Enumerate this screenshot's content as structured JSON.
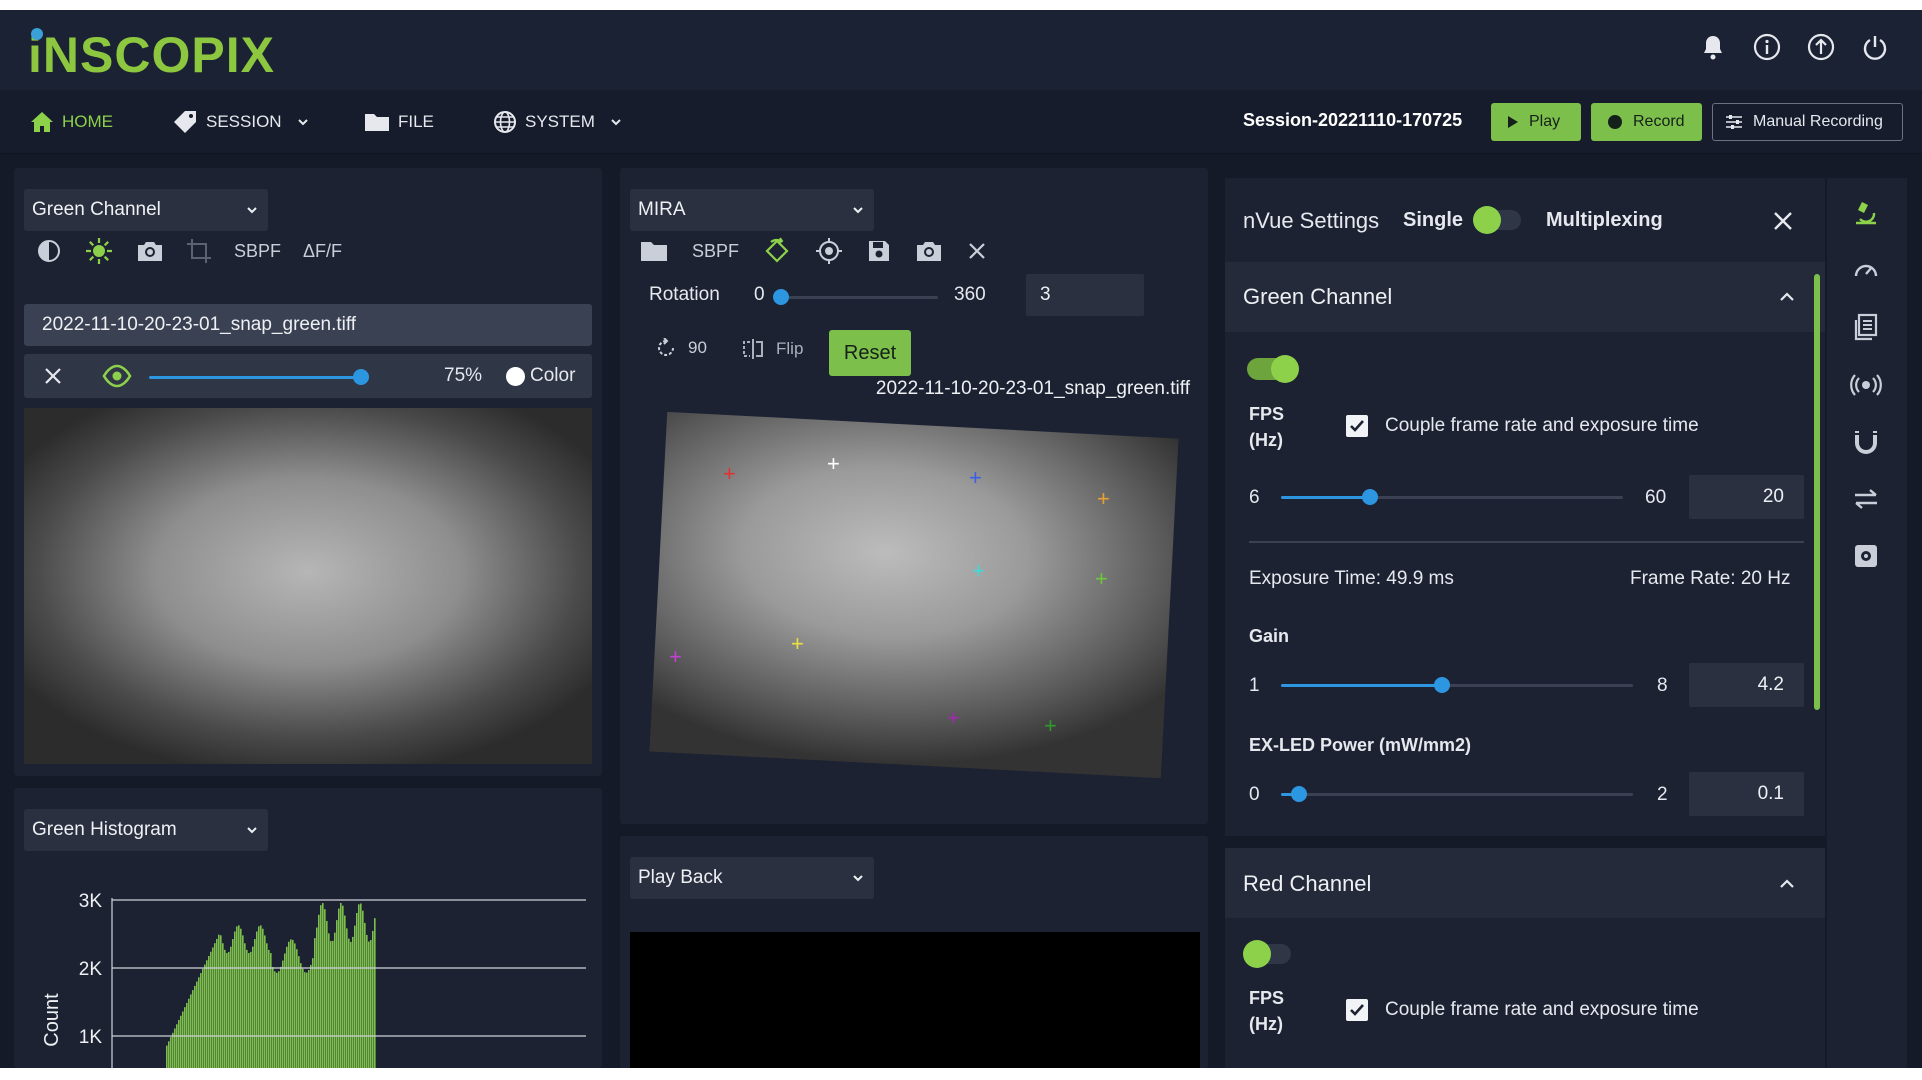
{
  "app": {
    "logo": "iNSCOPIX"
  },
  "topbar": {
    "icons": [
      "bell-icon",
      "info-icon",
      "upload-icon",
      "power-icon"
    ]
  },
  "nav": {
    "home": "HOME",
    "session": "SESSION",
    "file": "FILE",
    "system": "SYSTEM",
    "session_name": "Session-20221110-170725",
    "play": "Play",
    "record": "Record",
    "manual_recording": "Manual Recording"
  },
  "left_panel": {
    "channel_select": "Green Channel",
    "tools": {
      "sbpf": "SBPF",
      "dff": "ΔF/F"
    },
    "filename": "2022-11-10-20-23-01_snap_green.tiff",
    "opacity": "75%",
    "opacity_value": 0.75,
    "color_label": "Color"
  },
  "histogram": {
    "select": "Green Histogram",
    "chart_data": {
      "type": "bar",
      "ylabel": "Count",
      "yticks": [
        "3K",
        "2K",
        "1K"
      ],
      "ylim": [
        0,
        3000
      ],
      "color": "#7cc04b"
    }
  },
  "mira_panel": {
    "select": "MIRA",
    "tools": {
      "sbpf": "SBPF"
    },
    "rotation_label": "Rotation",
    "rotation_min": "0",
    "rotation_max": "360",
    "rotation_value": "3",
    "rotate90": "90",
    "flip": "Flip",
    "reset": "Reset",
    "filename": "2022-11-10-20-23-01_snap_green.tiff"
  },
  "playback": {
    "select": "Play Back"
  },
  "settings": {
    "title": "nVue Settings",
    "single": "Single",
    "multiplexing": "Multiplexing",
    "green": {
      "title": "Green Channel",
      "fps_label": "FPS (Hz)",
      "couple_label": "Couple frame rate and exposure time",
      "fps_min": "6",
      "fps_max": "60",
      "fps_value": "20",
      "exposure": "Exposure Time: 49.9 ms",
      "frame_rate": "Frame Rate: 20 Hz",
      "gain_label": "Gain",
      "gain_min": "1",
      "gain_max": "8",
      "gain_value": "4.2",
      "led_label": "EX-LED Power (mW/mm2)",
      "led_min": "0",
      "led_max": "2",
      "led_value": "0.1"
    },
    "red": {
      "title": "Red Channel",
      "fps_label": "FPS (Hz)",
      "couple_label": "Couple frame rate and exposure time"
    }
  },
  "colors": {
    "accent": "#7cc04b",
    "slider": "#2d96e0",
    "background": "#141a28"
  }
}
